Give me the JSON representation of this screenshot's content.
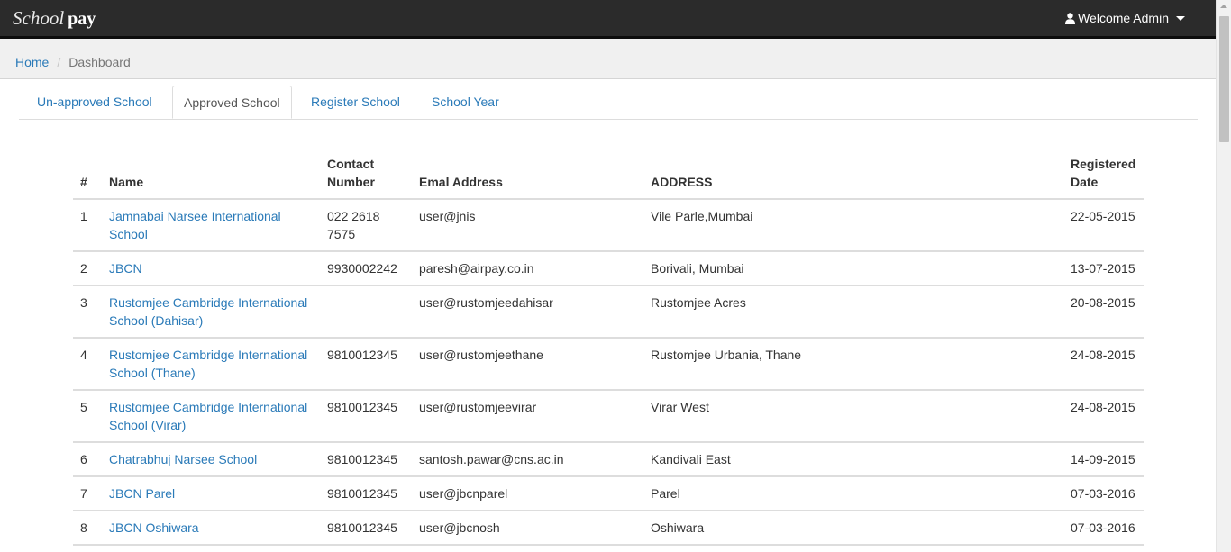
{
  "app": {
    "brand_school": "School",
    "brand_pay": "pay"
  },
  "user_menu": {
    "label": "Welcome Admin",
    "icon": "user-icon"
  },
  "breadcrumb": {
    "home": "Home",
    "separator": "/",
    "current": "Dashboard"
  },
  "tabs": [
    {
      "label": "Un-approved School",
      "active": false
    },
    {
      "label": "Approved School",
      "active": true
    },
    {
      "label": "Register School",
      "active": false
    },
    {
      "label": "School Year",
      "active": false
    }
  ],
  "table": {
    "headers": {
      "num": "#",
      "name": "Name",
      "contact": "Contact Number",
      "email": "Emal Address",
      "address": "ADDRESS",
      "date": "Registered Date"
    },
    "rows": [
      {
        "num": "1",
        "name": "Jamnabai Narsee International School",
        "contact": "022 2618 7575",
        "email": "user@jnis",
        "address": "Vile Parle,Mumbai",
        "date": "22-05-2015"
      },
      {
        "num": "2",
        "name": "JBCN",
        "contact": "9930002242",
        "email": "paresh@airpay.co.in",
        "address": "Borivali, Mumbai",
        "date": "13-07-2015"
      },
      {
        "num": "3",
        "name": "Rustomjee Cambridge International School (Dahisar)",
        "contact": "",
        "email": "user@rustomjeedahisar",
        "address": "Rustomjee Acres",
        "date": "20-08-2015"
      },
      {
        "num": "4",
        "name": "Rustomjee Cambridge International School (Thane)",
        "contact": "9810012345",
        "email": "user@rustomjeethane",
        "address": "Rustomjee Urbania, Thane",
        "date": "24-08-2015"
      },
      {
        "num": "5",
        "name": "Rustomjee Cambridge International School (Virar)",
        "contact": "9810012345",
        "email": "user@rustomjeevirar",
        "address": "Virar West",
        "date": "24-08-2015"
      },
      {
        "num": "6",
        "name": "Chatrabhuj Narsee School",
        "contact": "9810012345",
        "email": "santosh.pawar@cns.ac.in",
        "address": "Kandivali East",
        "date": "14-09-2015"
      },
      {
        "num": "7",
        "name": "JBCN Parel",
        "contact": "9810012345",
        "email": "user@jbcnparel",
        "address": "Parel",
        "date": "07-03-2016"
      },
      {
        "num": "8",
        "name": "JBCN Oshiwara",
        "contact": "9810012345",
        "email": "user@jbcnosh",
        "address": "Oshiwara",
        "date": "07-03-2016"
      }
    ]
  },
  "colors": {
    "navbar": "#2b2b2b",
    "link": "#2a7ab8",
    "breadcrumb_bg": "#f0f0f0"
  }
}
